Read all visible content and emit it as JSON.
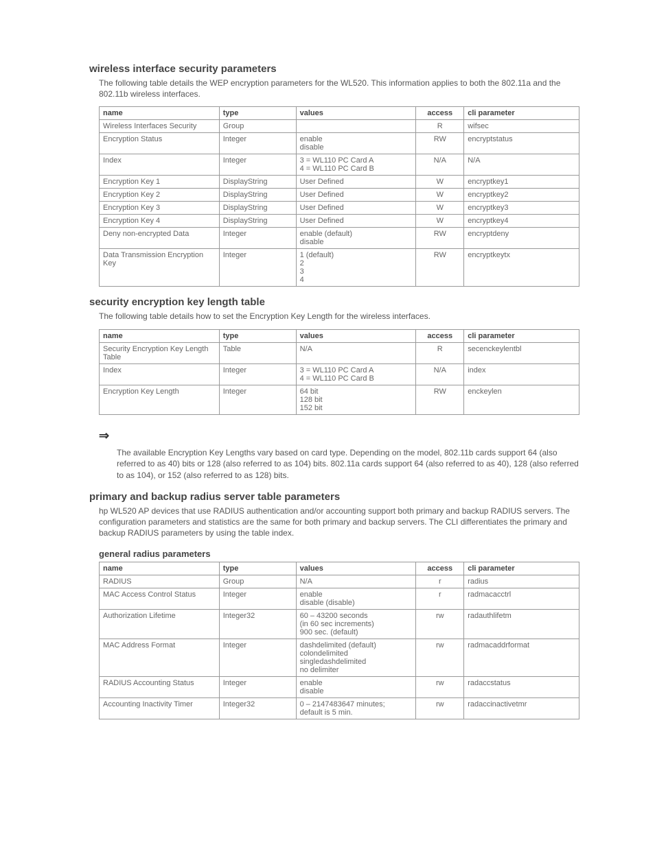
{
  "section1": {
    "heading": "wireless interface security parameters",
    "intro": "The following table details the WEP encryption parameters for the WL520. This information applies to both the 802.11a and the 802.11b wireless interfaces.",
    "headers": {
      "name": "name",
      "type": "type",
      "values": "values",
      "access": "access",
      "cli": "cli parameter"
    },
    "rows": [
      {
        "name": "Wireless Interfaces Security",
        "type": "Group",
        "values": "",
        "access": "R",
        "cli": "wifsec"
      },
      {
        "name": "Encryption Status",
        "type": "Integer",
        "values": "enable\ndisable",
        "access": "RW",
        "cli": "encryptstatus"
      },
      {
        "name": "Index",
        "type": "Integer",
        "values": "3 = WL110 PC Card A\n4 = WL110 PC Card B",
        "access": "N/A",
        "cli": "N/A"
      },
      {
        "name": "Encryption Key 1",
        "type": "DisplayString",
        "values": "User Defined",
        "access": "W",
        "cli": "encryptkey1"
      },
      {
        "name": "Encryption Key 2",
        "type": "DisplayString",
        "values": "User Defined",
        "access": "W",
        "cli": "encryptkey2"
      },
      {
        "name": "Encryption Key 3",
        "type": "DisplayString",
        "values": "User Defined",
        "access": "W",
        "cli": "encryptkey3"
      },
      {
        "name": "Encryption Key 4",
        "type": "DisplayString",
        "values": "User Defined",
        "access": "W",
        "cli": "encryptkey4"
      },
      {
        "name": "Deny non-encrypted Data",
        "type": "Integer",
        "values": "enable (default)\ndisable",
        "access": "RW",
        "cli": "encryptdeny"
      },
      {
        "name": "Data Transmission Encryption Key",
        "type": "Integer",
        "values": "1 (default)\n2\n3\n4",
        "access": "RW",
        "cli": "encryptkeytx"
      }
    ]
  },
  "section2": {
    "heading": "security encryption key length table",
    "intro": "The following table details how to set the Encryption Key Length for the wireless interfaces.",
    "headers": {
      "name": "name",
      "type": "type",
      "values": "values",
      "access": "access",
      "cli": "cli parameter"
    },
    "rows": [
      {
        "name": "Security Encryption Key Length Table",
        "type": "Table",
        "values": "N/A",
        "access": "R",
        "cli": "secenckeylentbl"
      },
      {
        "name": "Index",
        "type": "Integer",
        "values": "3 = WL110 PC Card A\n4 = WL110 PC Card B",
        "access": "N/A",
        "cli": "index"
      },
      {
        "name": "Encryption Key Length",
        "type": "Integer",
        "values": "64 bit\n128 bit\n152 bit",
        "access": "RW",
        "cli": "enckeylen"
      }
    ],
    "note": "The available Encryption Key Lengths vary based on card type. Depending on the model, 802.11b cards support 64 (also referred to as 40) bits or 128 (also referred to as 104) bits. 802.11a cards support 64 (also referred to as 40), 128 (also referred to as 104), or 152 (also referred to as 128) bits."
  },
  "section3": {
    "heading": "primary and backup radius server table parameters",
    "intro": "hp WL520 AP devices that use RADIUS authentication and/or accounting support both primary and backup RADIUS servers. The configuration parameters and statistics are the same for both primary and backup servers. The CLI differentiates the primary and backup RADIUS parameters by using the table index.",
    "subheading": "general radius parameters",
    "headers": {
      "name": "name",
      "type": "type",
      "values": "values",
      "access": "access",
      "cli": "cli parameter"
    },
    "rows": [
      {
        "name": "RADIUS",
        "type": "Group",
        "values": "N/A",
        "access": "r",
        "cli": "radius"
      },
      {
        "name": "MAC Access Control Status",
        "type": "Integer",
        "values": "enable\ndisable (disable)",
        "access": "r",
        "cli": "radmacacctrl"
      },
      {
        "name": "Authorization Lifetime",
        "type": "Integer32",
        "values": "60 – 43200 seconds\n(in 60 sec increments)\n900 sec. (default)",
        "access": "rw",
        "cli": "radauthlifetm"
      },
      {
        "name": "MAC Address Format",
        "type": "Integer",
        "values": "dashdelimited (default)\ncolondelimited\nsingledashdelimited\nno delimiter",
        "access": "rw",
        "cli": "radmacaddrformat"
      },
      {
        "name": "RADIUS Accounting Status",
        "type": "Integer",
        "values": "enable\ndisable",
        "access": "rw",
        "cli": "radaccstatus"
      },
      {
        "name": "Accounting Inactivity Timer",
        "type": "Integer32",
        "values": "0 – 2147483647 minutes;\ndefault is 5 min.",
        "access": "rw",
        "cli": "radaccinactivetmr"
      }
    ]
  }
}
